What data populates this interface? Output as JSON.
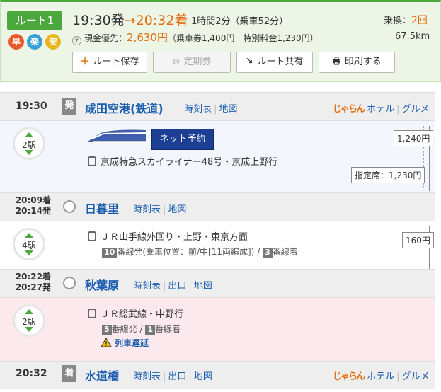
{
  "route": {
    "label": "ルート1",
    "badges": [
      "早",
      "楽",
      "安"
    ],
    "depart": "19:30発",
    "arrow": "→",
    "arrive": "20:32着",
    "duration": "1時間2分（乗車52分）",
    "transfers_label": "乗換：",
    "transfers_count": "2回",
    "fare_label": "現金優先：",
    "fare_amount": "2,630円",
    "fare_detail": "（乗車券1,400円　特別料金1,230円）",
    "distance": "67.5km",
    "yen_icon": "¥"
  },
  "actions": {
    "save": "ルート保存",
    "pass": "定期券",
    "share": "ルート共有",
    "print": "印刷する"
  },
  "stations": [
    {
      "time": "19:30",
      "tag": "発",
      "name": "成田空港(鉄道)",
      "links": [
        "時刻表",
        "地図"
      ],
      "hotel": "ホテル",
      "gourmet": "グルメ"
    },
    {
      "arr": "20:09着",
      "dep": "20:14発",
      "name": "日暮里",
      "links": [
        "時刻表",
        "地図"
      ]
    },
    {
      "arr": "20:22着",
      "dep": "20:27発",
      "name": "秋葉原",
      "links": [
        "時刻表",
        "出口",
        "地図"
      ]
    },
    {
      "time": "20:32",
      "tag": "着",
      "name": "水道橋",
      "links": [
        "時刻表",
        "出口",
        "地図"
      ],
      "hotel": "ホテル",
      "gourmet": "グルメ"
    }
  ],
  "segments": [
    {
      "stops": "2駅",
      "reserve": "ネット予約",
      "train": "京成特急スカイライナー48号・京成上野行",
      "fare": "1,240円",
      "reserved_fare": "指定席：1,230円",
      "color": "#e87722"
    },
    {
      "stops": "4駅",
      "train": "ＪＲ山手線外回り・上野・東京方面",
      "platform_dep": "10",
      "platform_dep_text": "番線発(乗車位置：前/中[11両編成])",
      "slash": "/",
      "platform_arr": "3",
      "platform_arr_text": "番線着",
      "fare": "160円",
      "color": "#39c22f"
    },
    {
      "stops": "2駅",
      "train": "ＪＲ総武線・中野行",
      "platform_dep": "5",
      "platform_dep_text": "番線発",
      "slash": "/",
      "platform_arr": "1",
      "platform_arr_text": "番線着",
      "delay": "列車遅延",
      "color": "#f2d21b"
    }
  ],
  "hotel_logo": "じゃらん",
  "icons": {
    "plus": "＋",
    "print": "🖶",
    "share": "⇲",
    "pass": "⊛"
  }
}
